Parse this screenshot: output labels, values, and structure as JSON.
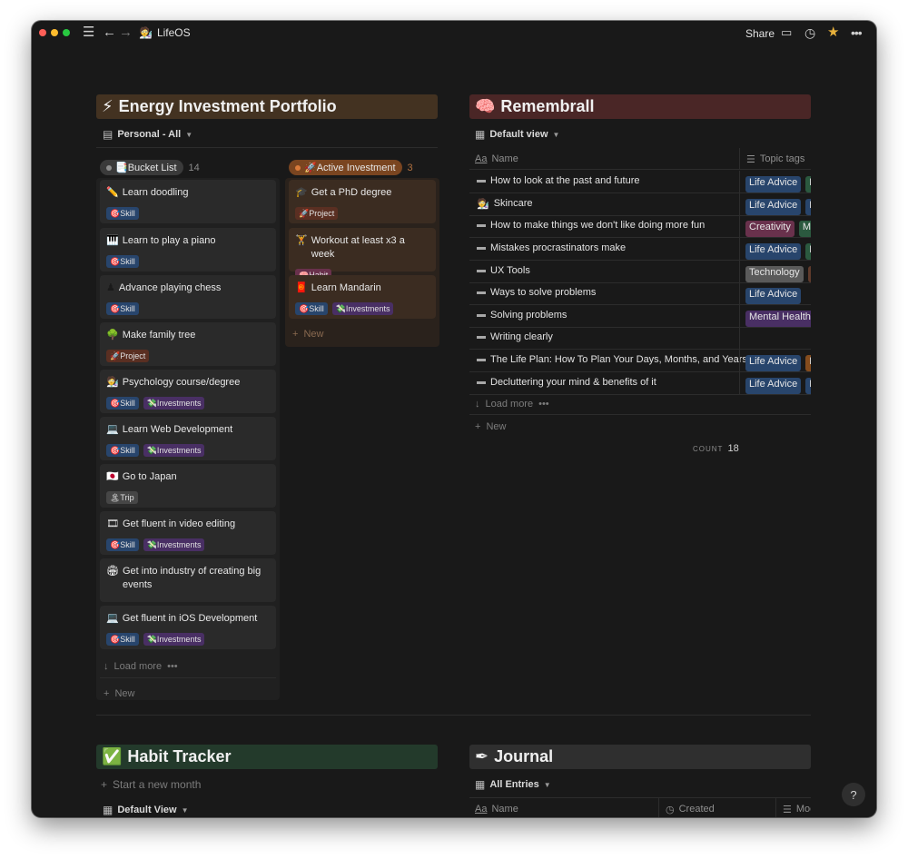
{
  "titlebar": {
    "page_icon": "🧑‍🔬",
    "page_title": "LifeOS",
    "share_label": "Share",
    "icons": [
      "sidebar-menu-icon",
      "back-arrow-icon",
      "forward-arrow-icon",
      "comment-icon",
      "clock-icon",
      "star-icon",
      "more-icon"
    ]
  },
  "energy": {
    "icon": "⚡",
    "title": "Energy Investment Portfolio",
    "view_label": "Personal - All",
    "columns": [
      {
        "label": "📑Bucket List",
        "count": "14",
        "cards": [
          {
            "icon": "✏️",
            "title": "Learn doodling",
            "tags": [
              "🎯Skill"
            ]
          },
          {
            "icon": "🎹",
            "title": "Learn to play a piano",
            "tags": [
              "🎯Skill"
            ]
          },
          {
            "icon": "♟",
            "title": "Advance playing chess",
            "tags": [
              "🎯Skill"
            ]
          },
          {
            "icon": "🌳",
            "title": "Make family tree",
            "tags": [
              "🚀Project"
            ]
          },
          {
            "icon": "🧑‍🔬",
            "title": "Psychology course/degree",
            "tags": [
              "🎯Skill",
              "💸Investments"
            ]
          },
          {
            "icon": "💻",
            "title": "Learn Web Development",
            "tags": [
              "🎯Skill",
              "💸Investments"
            ]
          },
          {
            "icon": "🇯🇵",
            "title": "Go to Japan",
            "tags": [
              "🏝Trip"
            ]
          },
          {
            "icon": "🎞",
            "title": "Get fluent in video editing",
            "tags": [
              "🎯Skill",
              "💸Investments"
            ]
          },
          {
            "icon": "🏟",
            "title": "Get into industry of creating big events",
            "tags": []
          },
          {
            "icon": "💻",
            "title": "Get fluent in iOS Development",
            "tags": [
              "🎯Skill",
              "💸Investments"
            ]
          }
        ],
        "load_more": "Load more",
        "new_label": "New"
      },
      {
        "label": "🚀Active Investment",
        "count": "3",
        "cards": [
          {
            "icon": "🎓",
            "title": "Get a PhD degree",
            "tags": [
              "🚀Project"
            ]
          },
          {
            "icon": "🏋",
            "title": "Workout at least x3 a week",
            "tags": [
              "🧠Habit"
            ]
          },
          {
            "icon": "🧧",
            "title": "Learn Mandarin",
            "tags": [
              "🎯Skill",
              "💸Investments"
            ]
          }
        ],
        "new_label": "New"
      }
    ]
  },
  "remembrall": {
    "icon": "🧠",
    "title": "Remembrall",
    "view_label": "Default view",
    "col_name": "Name",
    "col_tags": "Topic tags",
    "rows": [
      {
        "name": "How to look at the past and future",
        "tags": [
          "Life Advice",
          "M"
        ]
      },
      {
        "name": "Skincare",
        "tags": [
          "Life Advice",
          "H"
        ]
      },
      {
        "name": "How to make things we don't like doing more fun",
        "tags": [
          "Creativity",
          "Mo"
        ]
      },
      {
        "name": "Mistakes procrastinators make",
        "tags": [
          "Life Advice",
          "M"
        ]
      },
      {
        "name": "UX Tools",
        "tags": [
          "Technology",
          ""
        ]
      },
      {
        "name": "Ways to solve problems",
        "tags": [
          "Life Advice"
        ]
      },
      {
        "name": "Solving problems",
        "tags": [
          "Mental Health"
        ]
      },
      {
        "name": "Writing clearly",
        "tags": []
      },
      {
        "name": "The Life Plan: How To Plan Your Days, Months, and Years",
        "tags": [
          "Life Advice",
          "P"
        ]
      },
      {
        "name": "Decluttering your mind & benefits of it",
        "tags": [
          "Life Advice",
          "H"
        ]
      }
    ],
    "load_more": "Load more",
    "new_label": "New",
    "count_label": "COUNT",
    "count_value": "18"
  },
  "habit": {
    "icon": "✅",
    "title": "Habit Tracker",
    "new_month": "Start a new month",
    "view_label": "Default View"
  },
  "journal": {
    "icon": "✒",
    "title": "Journal",
    "view_label": "All Entries",
    "col_name": "Name",
    "col_created": "Created",
    "col_mood": "Moc"
  },
  "help_label": "?",
  "colors": {
    "background": "#191919",
    "energy_header": "#433221",
    "remembrall_header": "#4a2626",
    "habit_header": "#233a2b",
    "journal_header": "#2f2f2f",
    "bucket_pill": "#3a3a3a",
    "active_pill": "#7a4520"
  }
}
